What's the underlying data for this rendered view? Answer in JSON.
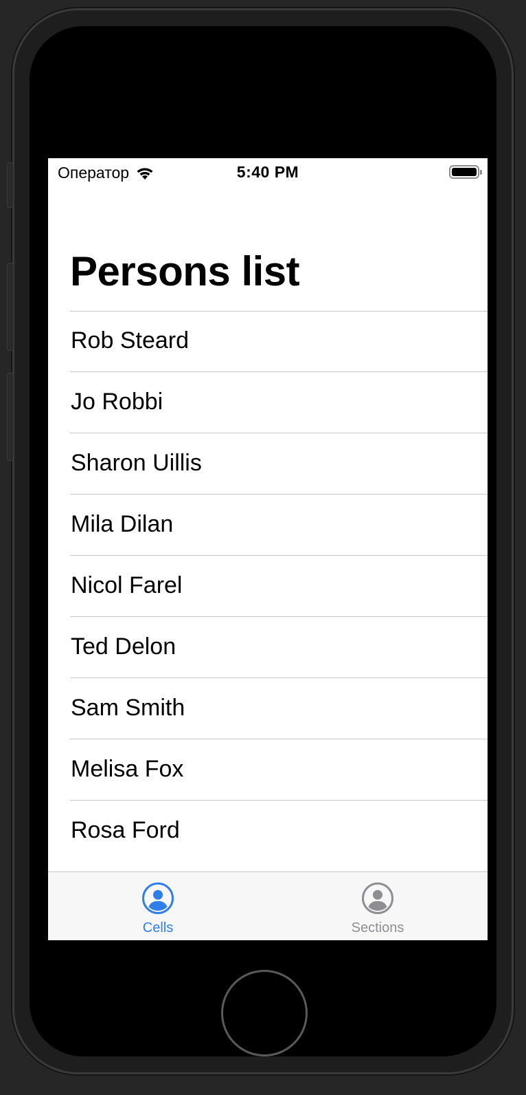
{
  "status_bar": {
    "carrier": "Оператор",
    "time": "5:40 PM",
    "wifi_icon": "wifi-icon",
    "battery_icon": "battery-full-icon"
  },
  "navigation": {
    "title": "Persons list"
  },
  "persons": [
    {
      "name": "Rob Steard"
    },
    {
      "name": "Jo Robbi"
    },
    {
      "name": "Sharon Uillis"
    },
    {
      "name": "Mila Dilan"
    },
    {
      "name": "Nicol Farel"
    },
    {
      "name": "Ted Delon"
    },
    {
      "name": "Sam Smith"
    },
    {
      "name": "Melisa Fox"
    },
    {
      "name": "Rosa Ford"
    }
  ],
  "tab_bar": {
    "tabs": [
      {
        "label": "Cells",
        "icon": "person-circle-icon",
        "selected": true,
        "color": "#2f7ee9"
      },
      {
        "label": "Sections",
        "icon": "person-circle-icon",
        "selected": false,
        "color": "#8e8e93"
      }
    ]
  },
  "colors": {
    "accent": "#2f7ee9",
    "inactive": "#8e8e93",
    "separator": "#c8c7cc"
  }
}
